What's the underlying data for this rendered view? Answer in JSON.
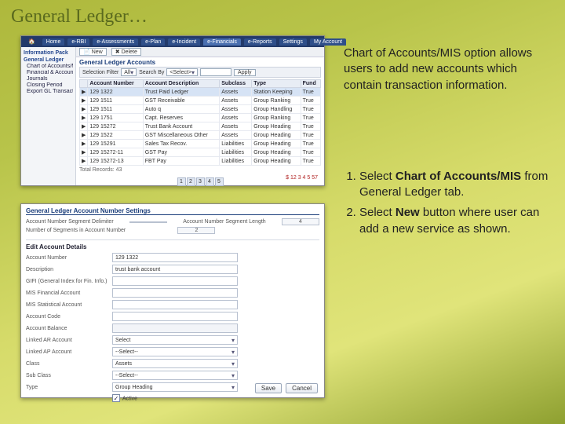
{
  "title": "General Ledger…",
  "desc": {
    "p1": "Chart of Accounts/MIS option allows users to add new accounts which contain transaction information.",
    "step1a": "Select ",
    "step1b": "Chart of Accounts/MIS",
    "step1c": " from General Ledger tab.",
    "step2a": "Select ",
    "step2b": "New",
    "step2c": " button where user can add a new service as shown."
  },
  "nav": {
    "items": [
      "Home",
      "e-RBI",
      "e-Assessments",
      "e-Plan",
      "e-Incident",
      "e-Financials",
      "e-Reports",
      "Settings",
      "My Account"
    ]
  },
  "toolbar": {
    "new": "New",
    "delete": "Delete"
  },
  "sidebar": {
    "h1": "Information Pack",
    "h2": "General Ledger",
    "items": [
      "Chart of Accounts/MIS",
      "Financial & Account Classes",
      "Journals",
      "Closing Period",
      "Export GL Transactions"
    ]
  },
  "grid": {
    "title": "General Ledger Accounts",
    "filters": {
      "label1": "Selection Filter",
      "v1": "All",
      "label2": "Search By",
      "v2": "<Select>",
      "btn": "Apply"
    },
    "columns": [
      "",
      "Account Number",
      "Account Description",
      "Subclass",
      "Type",
      "Fund"
    ],
    "rows": [
      {
        "sel": true,
        "num": "129 1322",
        "desc": "Trust Paid Ledger",
        "sub": "Assets",
        "type": "Station Keeping",
        "fund": "True"
      },
      {
        "num": "129 1511",
        "desc": "GST Receivable",
        "sub": "Assets",
        "type": "Group Ranking",
        "fund": "True"
      },
      {
        "num": "129 1511",
        "desc": "Auto q",
        "sub": "Assets",
        "type": "Group Handling",
        "fund": "True"
      },
      {
        "num": "129 1751",
        "desc": "Capt. Reserves",
        "sub": "Assets",
        "type": "Group Ranking",
        "fund": "True"
      },
      {
        "num": "129 15272",
        "desc": "Trust Bank Account",
        "sub": "Assets",
        "type": "Group Heading",
        "fund": "True"
      },
      {
        "num": "129 1522",
        "desc": "GST Miscellaneous Other",
        "sub": "Assets",
        "type": "Group Heading",
        "fund": "True"
      },
      {
        "num": "129 15291",
        "desc": "Sales Tax Recov.",
        "sub": "Liabilities",
        "type": "Group Heading",
        "fund": "True"
      },
      {
        "num": "129 15272-11",
        "desc": "GST Pay",
        "sub": "Liabilities",
        "type": "Group Heading",
        "fund": "True"
      },
      {
        "num": "129 15272-13",
        "desc": "FBT Pay",
        "sub": "Liabilities",
        "type": "Group Heading",
        "fund": "True"
      }
    ],
    "totalRecords": "Total Records: 43",
    "pages": [
      "1",
      "2",
      "3",
      "4",
      "5"
    ],
    "total": "$ 12 3 4 5 57"
  },
  "form": {
    "header": "General Ledger Account Number Settings",
    "seg1": {
      "label": "Account Number Segment Delimiter",
      "value": ""
    },
    "seg2": {
      "label": "Number of Segments in Account Number",
      "value": "2"
    },
    "seg3": {
      "label": "Account Number Segment Length",
      "value": "4"
    },
    "editHeader": "Edit Account Details",
    "fields": {
      "acctNum": {
        "label": "Account Number",
        "value": "129 1322"
      },
      "desc": {
        "label": "Description",
        "value": "trust bank account"
      },
      "gifi": {
        "label": "GIFI (General Index for Fin. Info.)",
        "value": ""
      },
      "misFin": {
        "label": "MIS Financial Account",
        "value": ""
      },
      "misStat": {
        "label": "MIS Statistical Account",
        "value": ""
      },
      "acctCode": {
        "label": "Account Code",
        "value": ""
      },
      "acctBal": {
        "label": "Account Balance",
        "value": ""
      },
      "linkedAR": {
        "label": "Linked AR Account",
        "value": "Select"
      },
      "linkedAP": {
        "label": "Linked AP Account",
        "value": "--Select--"
      },
      "class": {
        "label": "Class",
        "value": "Assets"
      },
      "subclass": {
        "label": "Sub Class",
        "value": "--Select--"
      },
      "type": {
        "label": "Type",
        "value": "Group Heading"
      },
      "active": {
        "label": "Active",
        "checked": "✓"
      }
    },
    "buttons": {
      "save": "Save",
      "cancel": "Cancel"
    }
  }
}
